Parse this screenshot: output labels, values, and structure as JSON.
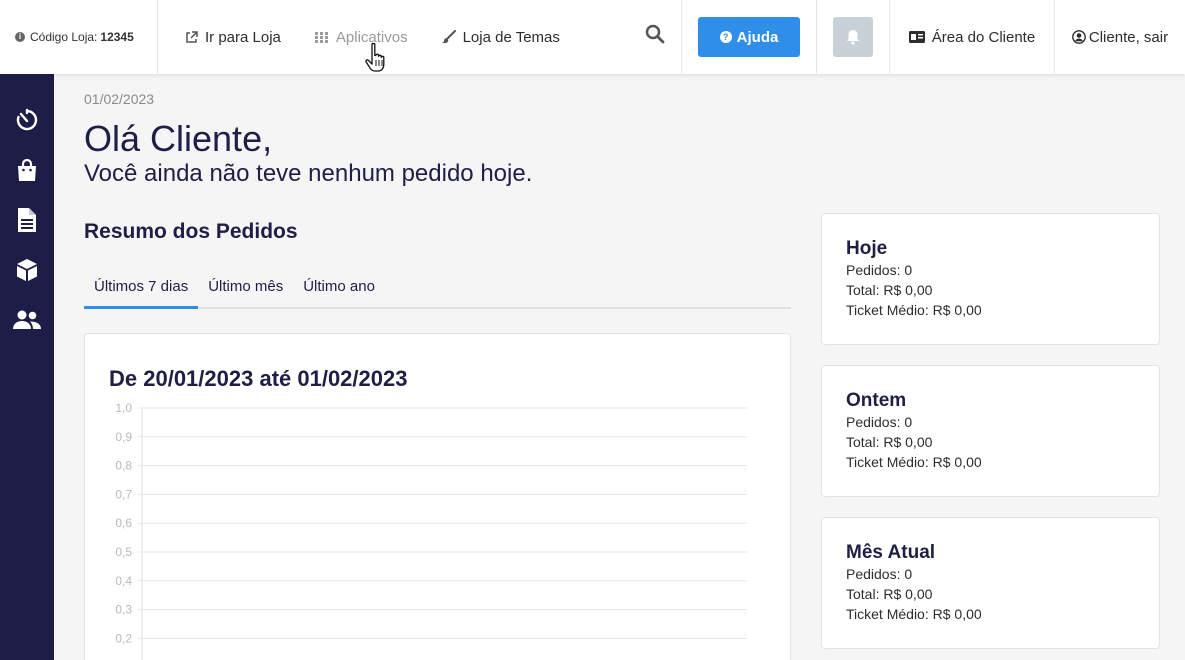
{
  "header": {
    "store_code_label": "Código Loja:",
    "store_code_value": "12345",
    "nav": [
      {
        "label": "Ir para Loja",
        "icon": "external-link-icon"
      },
      {
        "label": "Aplicativos",
        "icon": "grid-icon"
      },
      {
        "label": "Loja de Temas",
        "icon": "brush-icon"
      }
    ],
    "help_label": "Ajuda",
    "client_area_label": "Área do Cliente",
    "logout_label": "Cliente, sair"
  },
  "sidebar": {
    "items": [
      {
        "icon": "dashboard-icon"
      },
      {
        "icon": "shopping-bag-icon"
      },
      {
        "icon": "document-icon"
      },
      {
        "icon": "box-icon"
      },
      {
        "icon": "users-icon"
      }
    ]
  },
  "main": {
    "date": "01/02/2023",
    "greeting": "Olá Cliente,",
    "subgreeting": "Você ainda não teve nenhum pedido hoje.",
    "section_title": "Resumo dos Pedidos",
    "tabs": [
      {
        "label": "Últimos 7 dias",
        "active": true
      },
      {
        "label": "Último mês",
        "active": false
      },
      {
        "label": "Último ano",
        "active": false
      }
    ]
  },
  "chart_data": {
    "type": "line",
    "title": "De 20/01/2023 até 01/02/2023",
    "ylim": [
      0,
      1.0
    ],
    "yticks": [
      "1,0",
      "0,9",
      "0,8",
      "0,7",
      "0,6",
      "0,5",
      "0,4",
      "0,3",
      "0,2"
    ],
    "grid": true,
    "series": []
  },
  "stats": [
    {
      "title": "Hoje",
      "pedidos": "Pedidos: 0",
      "total": "Total: R$ 0,00",
      "ticket": "Ticket Médio: R$ 0,00"
    },
    {
      "title": "Ontem",
      "pedidos": "Pedidos: 0",
      "total": "Total: R$ 0,00",
      "ticket": "Ticket Médio: R$ 0,00"
    },
    {
      "title": "Mês Atual",
      "pedidos": "Pedidos: 0",
      "total": "Total: R$ 0,00",
      "ticket": "Ticket Médio: R$ 0,00"
    }
  ],
  "colors": {
    "accent": "#2f8fe8",
    "sidebar": "#1d1d47",
    "text": "#1e1e46"
  }
}
